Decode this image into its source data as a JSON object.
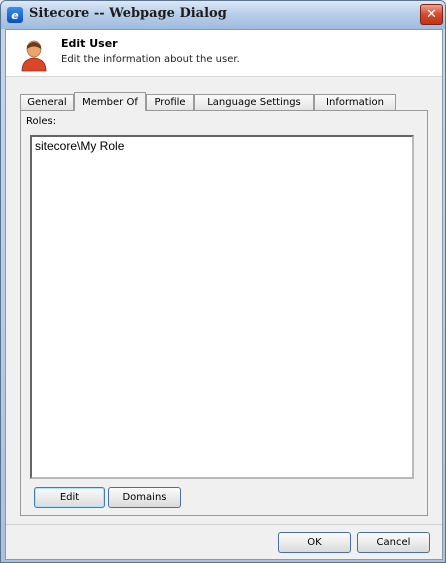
{
  "window": {
    "title": "Sitecore -- Webpage Dialog",
    "close_glyph": "✕",
    "icon": "ie-icon",
    "icon_glyph": "e"
  },
  "header": {
    "title": "Edit User",
    "subtitle": "Edit the information about the user.",
    "icon": "user-avatar-icon"
  },
  "tabs": [
    {
      "label": "General",
      "active": false
    },
    {
      "label": "Member Of",
      "active": true
    },
    {
      "label": "Profile",
      "active": false
    },
    {
      "label": "Language Settings",
      "active": false
    },
    {
      "label": "Information",
      "active": false
    }
  ],
  "roles": {
    "label": "Roles:",
    "items": [
      "sitecore\\My Role"
    ]
  },
  "panel_buttons": {
    "edit": "Edit",
    "domains": "Domains"
  },
  "footer": {
    "ok": "OK",
    "cancel": "Cancel"
  },
  "colors": {
    "accent": "#3c7fb1",
    "close": "#d44a2c"
  }
}
